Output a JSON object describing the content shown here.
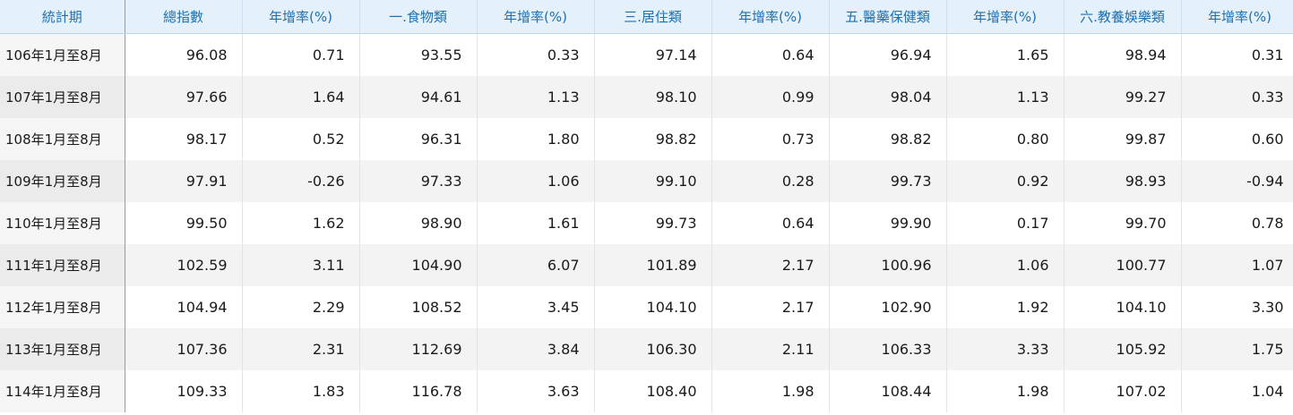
{
  "headers": [
    "統計期",
    "總指數",
    "年增率(%)",
    "一.食物類",
    "年增率(%)",
    "三.居住類",
    "年增率(%)",
    "五.醫藥保健類",
    "年增率(%)",
    "六.教養娛樂類",
    "年增率(%)"
  ],
  "rows": [
    [
      "106年1月至8月",
      "96.08",
      "0.71",
      "93.55",
      "0.33",
      "97.14",
      "0.64",
      "96.94",
      "1.65",
      "98.94",
      "0.31"
    ],
    [
      "107年1月至8月",
      "97.66",
      "1.64",
      "94.61",
      "1.13",
      "98.10",
      "0.99",
      "98.04",
      "1.13",
      "99.27",
      "0.33"
    ],
    [
      "108年1月至8月",
      "98.17",
      "0.52",
      "96.31",
      "1.80",
      "98.82",
      "0.73",
      "98.82",
      "0.80",
      "99.87",
      "0.60"
    ],
    [
      "109年1月至8月",
      "97.91",
      "-0.26",
      "97.33",
      "1.06",
      "99.10",
      "0.28",
      "99.73",
      "0.92",
      "98.93",
      "-0.94"
    ],
    [
      "110年1月至8月",
      "99.50",
      "1.62",
      "98.90",
      "1.61",
      "99.73",
      "0.64",
      "99.90",
      "0.17",
      "99.70",
      "0.78"
    ],
    [
      "111年1月至8月",
      "102.59",
      "3.11",
      "104.90",
      "6.07",
      "101.89",
      "2.17",
      "100.96",
      "1.06",
      "100.77",
      "1.07"
    ],
    [
      "112年1月至8月",
      "104.94",
      "2.29",
      "108.52",
      "3.45",
      "104.10",
      "2.17",
      "102.90",
      "1.92",
      "104.10",
      "3.30"
    ],
    [
      "113年1月至8月",
      "107.36",
      "2.31",
      "112.69",
      "3.84",
      "106.30",
      "2.11",
      "106.33",
      "3.33",
      "105.92",
      "1.75"
    ],
    [
      "114年1月至8月",
      "109.33",
      "1.83",
      "116.78",
      "3.63",
      "108.40",
      "1.98",
      "108.44",
      "1.98",
      "107.02",
      "1.04"
    ]
  ]
}
